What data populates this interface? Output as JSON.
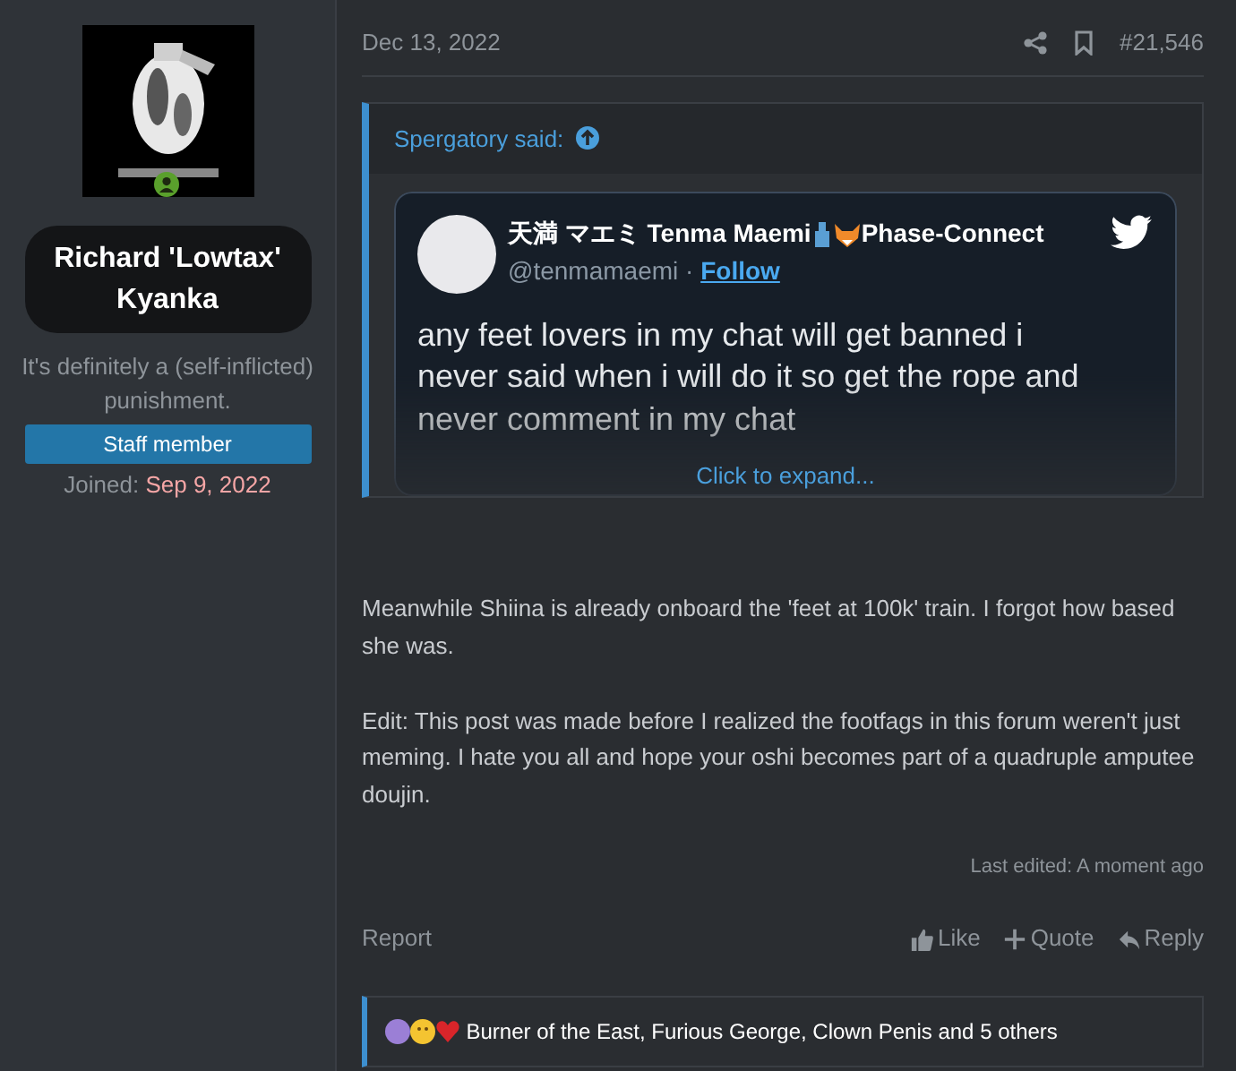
{
  "author": {
    "name": "Richard 'Lowtax' Kyanka",
    "title": "It's definitely a (self-inflicted) punishment.",
    "banner": "Staff member",
    "joined_label": "Joined:",
    "joined_date": "Sep 9, 2022",
    "online": true
  },
  "post": {
    "date": "Dec 13, 2022",
    "number": "#21,546",
    "bookmarked": false
  },
  "quote": {
    "attribution": "Spergatory said:",
    "tweet": {
      "name_1": "天満 マエミ Tenma Maemi",
      "name_2": "Phase-Connect",
      "handle": "@tenmamaemi",
      "separator": "·",
      "follow": "Follow",
      "lines": [
        "any feet lovers in my chat will  get banned i",
        "never said when i will do it so get the rope and",
        "never comment in my chat"
      ]
    },
    "expand": "Click to expand..."
  },
  "body": [
    "Meanwhile Shiina is already onboard the 'feet at 100k' train. I forgot how based she was.",
    "Edit: This post was made before I realized the footfags in this forum weren't just meming. I hate you all and hope your oshi becomes part of a quadruple amputee doujin."
  ],
  "last_edited": "Last edited: A moment ago",
  "actions": {
    "report": "Report",
    "buttons": [
      {
        "kind": "like",
        "label": "Like"
      },
      {
        "kind": "quote",
        "label": "Quote"
      },
      {
        "kind": "reply",
        "label": "Reply"
      }
    ]
  },
  "reactions": {
    "text": "Burner of the East, Furious George, Clown Penis and 5 others"
  }
}
